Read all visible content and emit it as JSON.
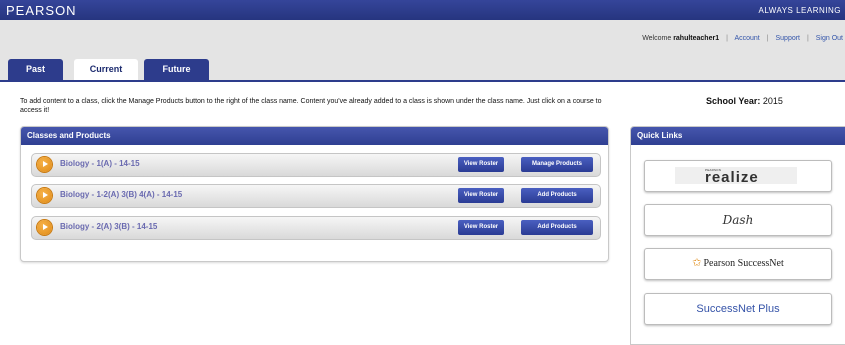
{
  "header": {
    "brand": "PEARSON",
    "tagline": "ALWAYS LEARNING"
  },
  "user_bar": {
    "welcome_prefix": "Welcome ",
    "username": "rahulteacher1",
    "links": [
      "Account",
      "Support",
      "Sign Out"
    ]
  },
  "tabs": [
    {
      "label": "Past",
      "active": false
    },
    {
      "label": "Current",
      "active": true
    },
    {
      "label": "Future",
      "active": false
    }
  ],
  "instructions": "To add content to a class, click the Manage Products button to the right of the class name. Content you've already added to a class  is shown under the class name. Just click on a course to access it!",
  "school_year": {
    "label": "School Year:",
    "value": "2015"
  },
  "classes_panel": {
    "title": "Classes and Products",
    "rows": [
      {
        "name": "Biology - 1(A) - 14-15",
        "roster_label": "View Roster",
        "action_label": "Manage Products"
      },
      {
        "name": "Biology - 1-2(A) 3(B) 4(A) - 14-15",
        "roster_label": "View Roster",
        "action_label": "Add Products"
      },
      {
        "name": "Biology - 2(A) 3(B) - 14-15",
        "roster_label": "View Roster",
        "action_label": "Add Products"
      }
    ]
  },
  "quick_links": {
    "title": "Quick Links",
    "items": [
      {
        "label": "realize",
        "sublabel": "PEARSON"
      },
      {
        "label": "Dash"
      },
      {
        "label": "Pearson SuccessNet"
      },
      {
        "label": "SuccessNet Plus"
      }
    ]
  },
  "colors": {
    "brand_blue": "#2d3c8c",
    "accent_orange": "#e08a14",
    "class_name_text": "#6a6ab0"
  }
}
